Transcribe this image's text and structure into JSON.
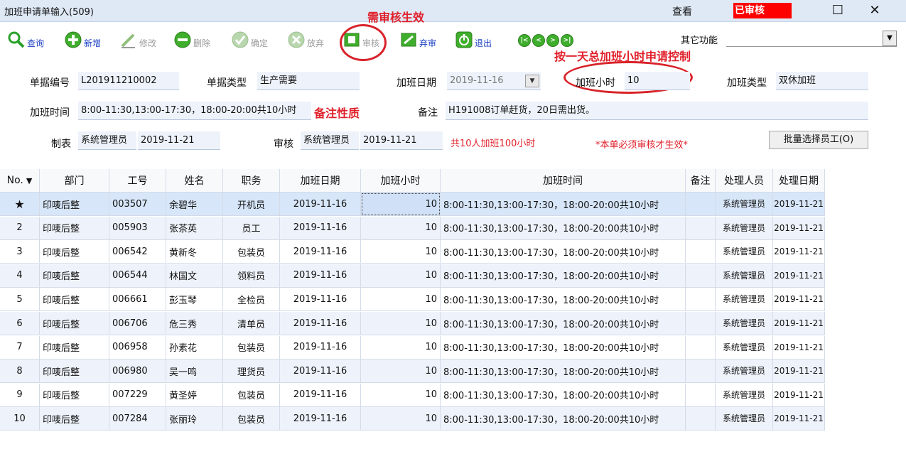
{
  "window": {
    "title": "加班申请单输入(509)",
    "view_label": "查看",
    "status": "已审核",
    "status_color": "#ff0000",
    "maximize_icon": "☐",
    "close_icon": "✕"
  },
  "toolbar": {
    "query": "查询",
    "add": "新增",
    "edit": "修改",
    "delete": "删除",
    "confirm": "确定",
    "abandon": "放弃",
    "audit": "审核",
    "unaudit": "弃审",
    "exit": "退出",
    "other_label": "其它功能",
    "other_value": ""
  },
  "annotations": {
    "audit_note": "需审核生效",
    "hours_note": "按一天总加班小时申请控制",
    "remark_note": "备注性质"
  },
  "form": {
    "doc_no_label": "单据编号",
    "doc_no": "L201911210002",
    "doc_type_label": "单据类型",
    "doc_type": "生产需要",
    "ot_date_label": "加班日期",
    "ot_date": "2019-11-16",
    "ot_hours_label": "加班小时",
    "ot_hours": "10",
    "ot_type_label": "加班类型",
    "ot_type": "双休加班",
    "ot_time_label": "加班时间",
    "ot_time": "8:00-11:30,13:00-17:30，18:00-20:00共10小时",
    "remark_label": "备注",
    "remark": "H191008订单赶货，20日需出货。",
    "maker_label": "制表",
    "maker": "系统管理员",
    "make_date": "2019-11-21",
    "auditor_label": "审核",
    "auditor": "系统管理员",
    "audit_date": "2019-11-21",
    "total_text": "共10人加班100小时",
    "must_audit_text": "*本单必须审核才生效*",
    "batch_button": "批量选择员工(O)"
  },
  "table": {
    "columns": [
      "No.",
      "部门",
      "工号",
      "姓名",
      "职务",
      "加班日期",
      "加班小时",
      "加班时间",
      "备注",
      "处理人员",
      "处理日期"
    ],
    "rows": [
      {
        "no": "★",
        "dept": "印唛后整",
        "id": "003507",
        "name": "余碧华",
        "job": "开机员",
        "date": "2019-11-16",
        "hours": "10",
        "time": "8:00-11:30,13:00-17:30，18:00-20:00共10小时",
        "remark": "",
        "handler": "系统管理员",
        "hdate": "2019-11-21"
      },
      {
        "no": "2",
        "dept": "印唛后整",
        "id": "005903",
        "name": "张茶英",
        "job": "员工",
        "date": "2019-11-16",
        "hours": "10",
        "time": "8:00-11:30,13:00-17:30，18:00-20:00共10小时",
        "remark": "",
        "handler": "系统管理员",
        "hdate": "2019-11-21"
      },
      {
        "no": "3",
        "dept": "印唛后整",
        "id": "006542",
        "name": "黄新冬",
        "job": "包装员",
        "date": "2019-11-16",
        "hours": "10",
        "time": "8:00-11:30,13:00-17:30，18:00-20:00共10小时",
        "remark": "",
        "handler": "系统管理员",
        "hdate": "2019-11-21"
      },
      {
        "no": "4",
        "dept": "印唛后整",
        "id": "006544",
        "name": "林国文",
        "job": "领料员",
        "date": "2019-11-16",
        "hours": "10",
        "time": "8:00-11:30,13:00-17:30，18:00-20:00共10小时",
        "remark": "",
        "handler": "系统管理员",
        "hdate": "2019-11-21"
      },
      {
        "no": "5",
        "dept": "印唛后整",
        "id": "006661",
        "name": "彭玉琴",
        "job": "全检员",
        "date": "2019-11-16",
        "hours": "10",
        "time": "8:00-11:30,13:00-17:30，18:00-20:00共10小时",
        "remark": "",
        "handler": "系统管理员",
        "hdate": "2019-11-21"
      },
      {
        "no": "6",
        "dept": "印唛后整",
        "id": "006706",
        "name": "危三秀",
        "job": "清单员",
        "date": "2019-11-16",
        "hours": "10",
        "time": "8:00-11:30,13:00-17:30，18:00-20:00共10小时",
        "remark": "",
        "handler": "系统管理员",
        "hdate": "2019-11-21"
      },
      {
        "no": "7",
        "dept": "印唛后整",
        "id": "006958",
        "name": "孙素花",
        "job": "包装员",
        "date": "2019-11-16",
        "hours": "10",
        "time": "8:00-11:30,13:00-17:30，18:00-20:00共10小时",
        "remark": "",
        "handler": "系统管理员",
        "hdate": "2019-11-21"
      },
      {
        "no": "8",
        "dept": "印唛后整",
        "id": "006980",
        "name": "吴一鸣",
        "job": "理货员",
        "date": "2019-11-16",
        "hours": "10",
        "time": "8:00-11:30,13:00-17:30，18:00-20:00共10小时",
        "remark": "",
        "handler": "系统管理员",
        "hdate": "2019-11-21"
      },
      {
        "no": "9",
        "dept": "印唛后整",
        "id": "007229",
        "name": "黄圣婷",
        "job": "包装员",
        "date": "2019-11-16",
        "hours": "10",
        "time": "8:00-11:30,13:00-17:30，18:00-20:00共10小时",
        "remark": "",
        "handler": "系统管理员",
        "hdate": "2019-11-21"
      },
      {
        "no": "10",
        "dept": "印唛后整",
        "id": "007284",
        "name": "张丽玲",
        "job": "包装员",
        "date": "2019-11-16",
        "hours": "10",
        "time": "8:00-11:30,13:00-17:30，18:00-20:00共10小时",
        "remark": "",
        "handler": "系统管理员",
        "hdate": "2019-11-21"
      }
    ]
  }
}
